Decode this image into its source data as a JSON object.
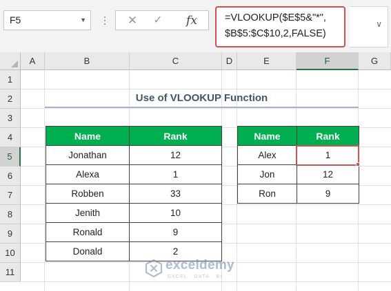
{
  "formula_bar": {
    "name_box": "F5",
    "cancel_glyph": "✕",
    "enter_glyph": "✓",
    "fx_glyph": "fx",
    "formula": "=VLOOKUP($E$5&\"*\",\n$B$5:$C$10,2,FALSE)"
  },
  "grid": {
    "columns": [
      "A",
      "B",
      "C",
      "D",
      "E",
      "F",
      "G"
    ],
    "rows": [
      "1",
      "2",
      "3",
      "4",
      "5",
      "6",
      "7",
      "8",
      "9",
      "10",
      "11"
    ],
    "selected_column": "F",
    "selected_row": "5",
    "active_cell": "F5"
  },
  "sheet": {
    "title": "Use of VLOOKUP Function",
    "source_table": {
      "headers": [
        "Name",
        "Rank"
      ],
      "rows": [
        [
          "Jonathan",
          "12"
        ],
        [
          "Alexa",
          "1"
        ],
        [
          "Robben",
          "33"
        ],
        [
          "Jenith",
          "10"
        ],
        [
          "Ronald",
          "9"
        ],
        [
          "Donald",
          "2"
        ]
      ]
    },
    "result_table": {
      "headers": [
        "Name",
        "Rank"
      ],
      "rows": [
        [
          "Alex",
          "1"
        ],
        [
          "Jon",
          "12"
        ],
        [
          "Ron",
          "9"
        ]
      ]
    }
  },
  "watermark": {
    "name": "exceldemy",
    "tagline": "EXCEL · DATA · BI"
  },
  "colors": {
    "header_green": "#00b050",
    "title_text": "#44546a",
    "title_underline": "#a5b2d6",
    "selection_red": "#d05050",
    "selection_green": "#217346"
  }
}
